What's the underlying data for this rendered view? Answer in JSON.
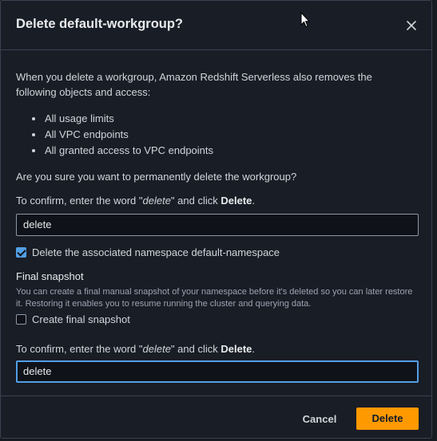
{
  "dialog": {
    "title": "Delete default-workgroup?",
    "intro": "When you delete a workgroup, Amazon Redshift Serverless also removes the following objects and access:",
    "items": [
      "All usage limits",
      "All VPC endpoints",
      "All granted access to VPC endpoints"
    ],
    "question": "Are you sure you want to permanently delete the workgroup?",
    "confirm_prefix": "To confirm, enter the word \"",
    "confirm_word": "delete",
    "confirm_middle": "\" and click ",
    "confirm_action": "Delete",
    "confirm_suffix": ".",
    "input1_value": "delete",
    "namespace_checkbox": {
      "label": "Delete the associated namespace default-namespace",
      "checked": true
    },
    "snapshot_title": "Final snapshot",
    "snapshot_desc": "You can create a final manual snapshot of your namespace before it's deleted so you can later restore it. Restoring it enables you to resume running the cluster and querying data.",
    "snapshot_checkbox": {
      "label": "Create final snapshot",
      "checked": false
    },
    "input2_value": "delete"
  },
  "footer": {
    "cancel_label": "Cancel",
    "delete_label": "Delete"
  },
  "colors": {
    "accent": "#ff9900",
    "focus": "#539fe5",
    "background": "#191d26"
  }
}
